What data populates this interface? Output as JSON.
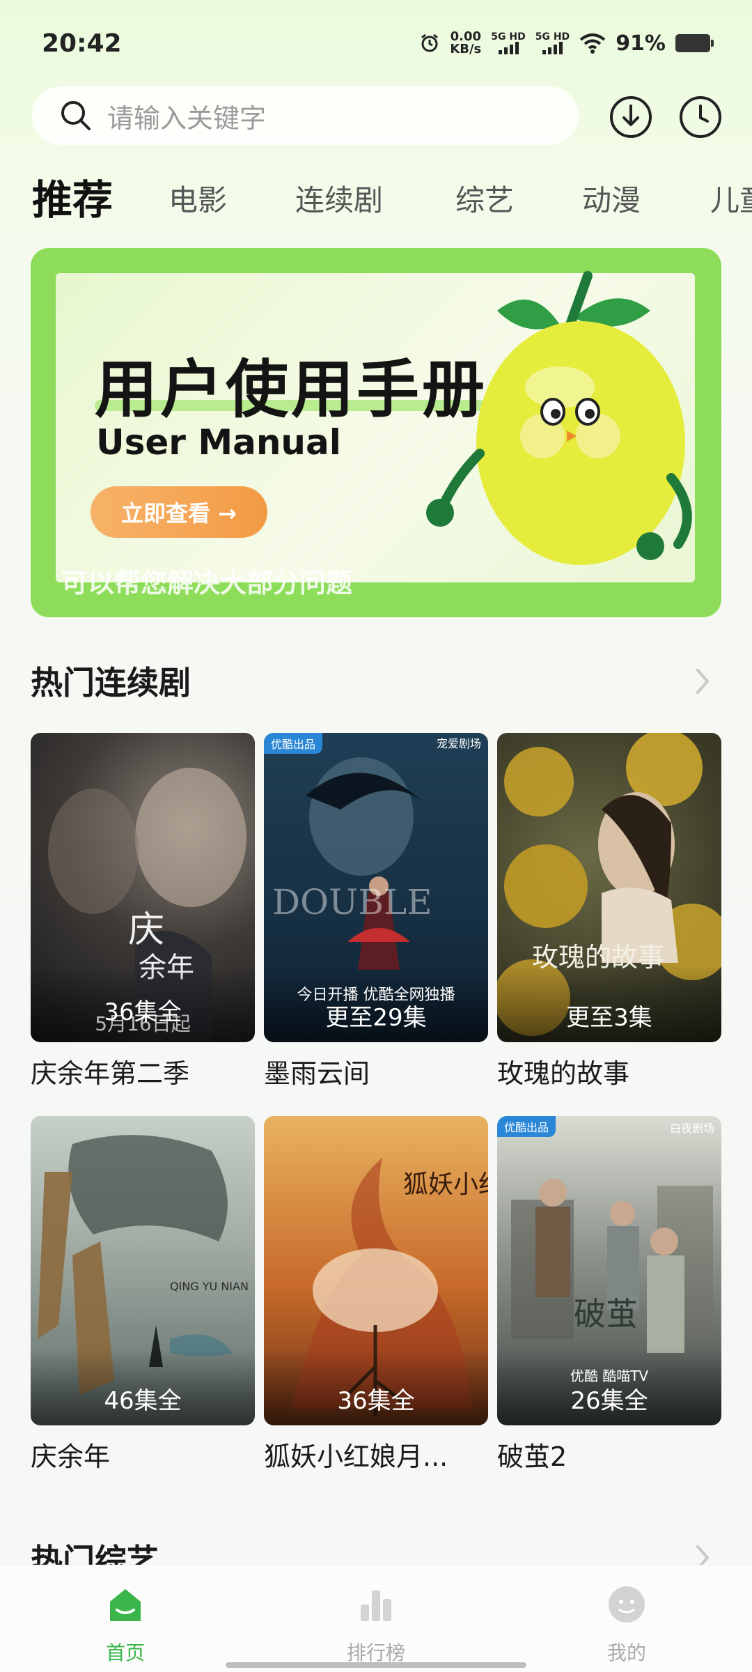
{
  "status_bar": {
    "time": "20:42",
    "net_speed_value": "0.00",
    "net_speed_unit": "KB/s",
    "sim1_label": "5G HD",
    "sim2_label": "5G HD",
    "battery_percent": "91%"
  },
  "search": {
    "placeholder": "请输入关键字"
  },
  "header_icons": [
    "download-icon",
    "history-icon"
  ],
  "tabs": [
    {
      "label": "推荐",
      "active": true
    },
    {
      "label": "电影"
    },
    {
      "label": "连续剧"
    },
    {
      "label": "综艺"
    },
    {
      "label": "动漫"
    },
    {
      "label": "儿童"
    }
  ],
  "banner": {
    "title": "用户使用手册",
    "subtitle": "User Manual",
    "button_label": "立即查看 →",
    "caption": "可以帮您解决大部分问题"
  },
  "sections": {
    "hot_series": {
      "title": "热门连续剧",
      "items": [
        {
          "title": "庆余年第二季",
          "badge": "36集全",
          "overlay_text": "5月16日起"
        },
        {
          "title": "墨雨云间",
          "badge": "更至29集",
          "overlay_text": "今日开播 优酷全网独播",
          "tag": "优酷出品",
          "tag2": "宠爱剧场",
          "art_text": "DOUBLE"
        },
        {
          "title": "玫瑰的故事",
          "badge": "更至3集",
          "art_text": "玫瑰的故事"
        },
        {
          "title": "庆余年",
          "badge": "46集全",
          "art_text": "QING YU NIAN"
        },
        {
          "title": "狐妖小红娘月...",
          "badge": "36集全",
          "art_text": "狐妖小红娘"
        },
        {
          "title": "破茧2",
          "badge": "26集全",
          "tag": "优酷出品",
          "tag2": "白夜剧场",
          "overlay_text": "优酷 酷喵TV"
        }
      ]
    },
    "hot_variety": {
      "title": "热门综艺"
    }
  },
  "bottom_nav": [
    {
      "label": "首页",
      "icon": "home-icon",
      "active": true
    },
    {
      "label": "排行榜",
      "icon": "ranking-icon"
    },
    {
      "label": "我的",
      "icon": "profile-icon"
    }
  ],
  "colors": {
    "accent": "#39b54a",
    "banner_green": "#8ddd5a",
    "button_orange": "#f39a43"
  }
}
